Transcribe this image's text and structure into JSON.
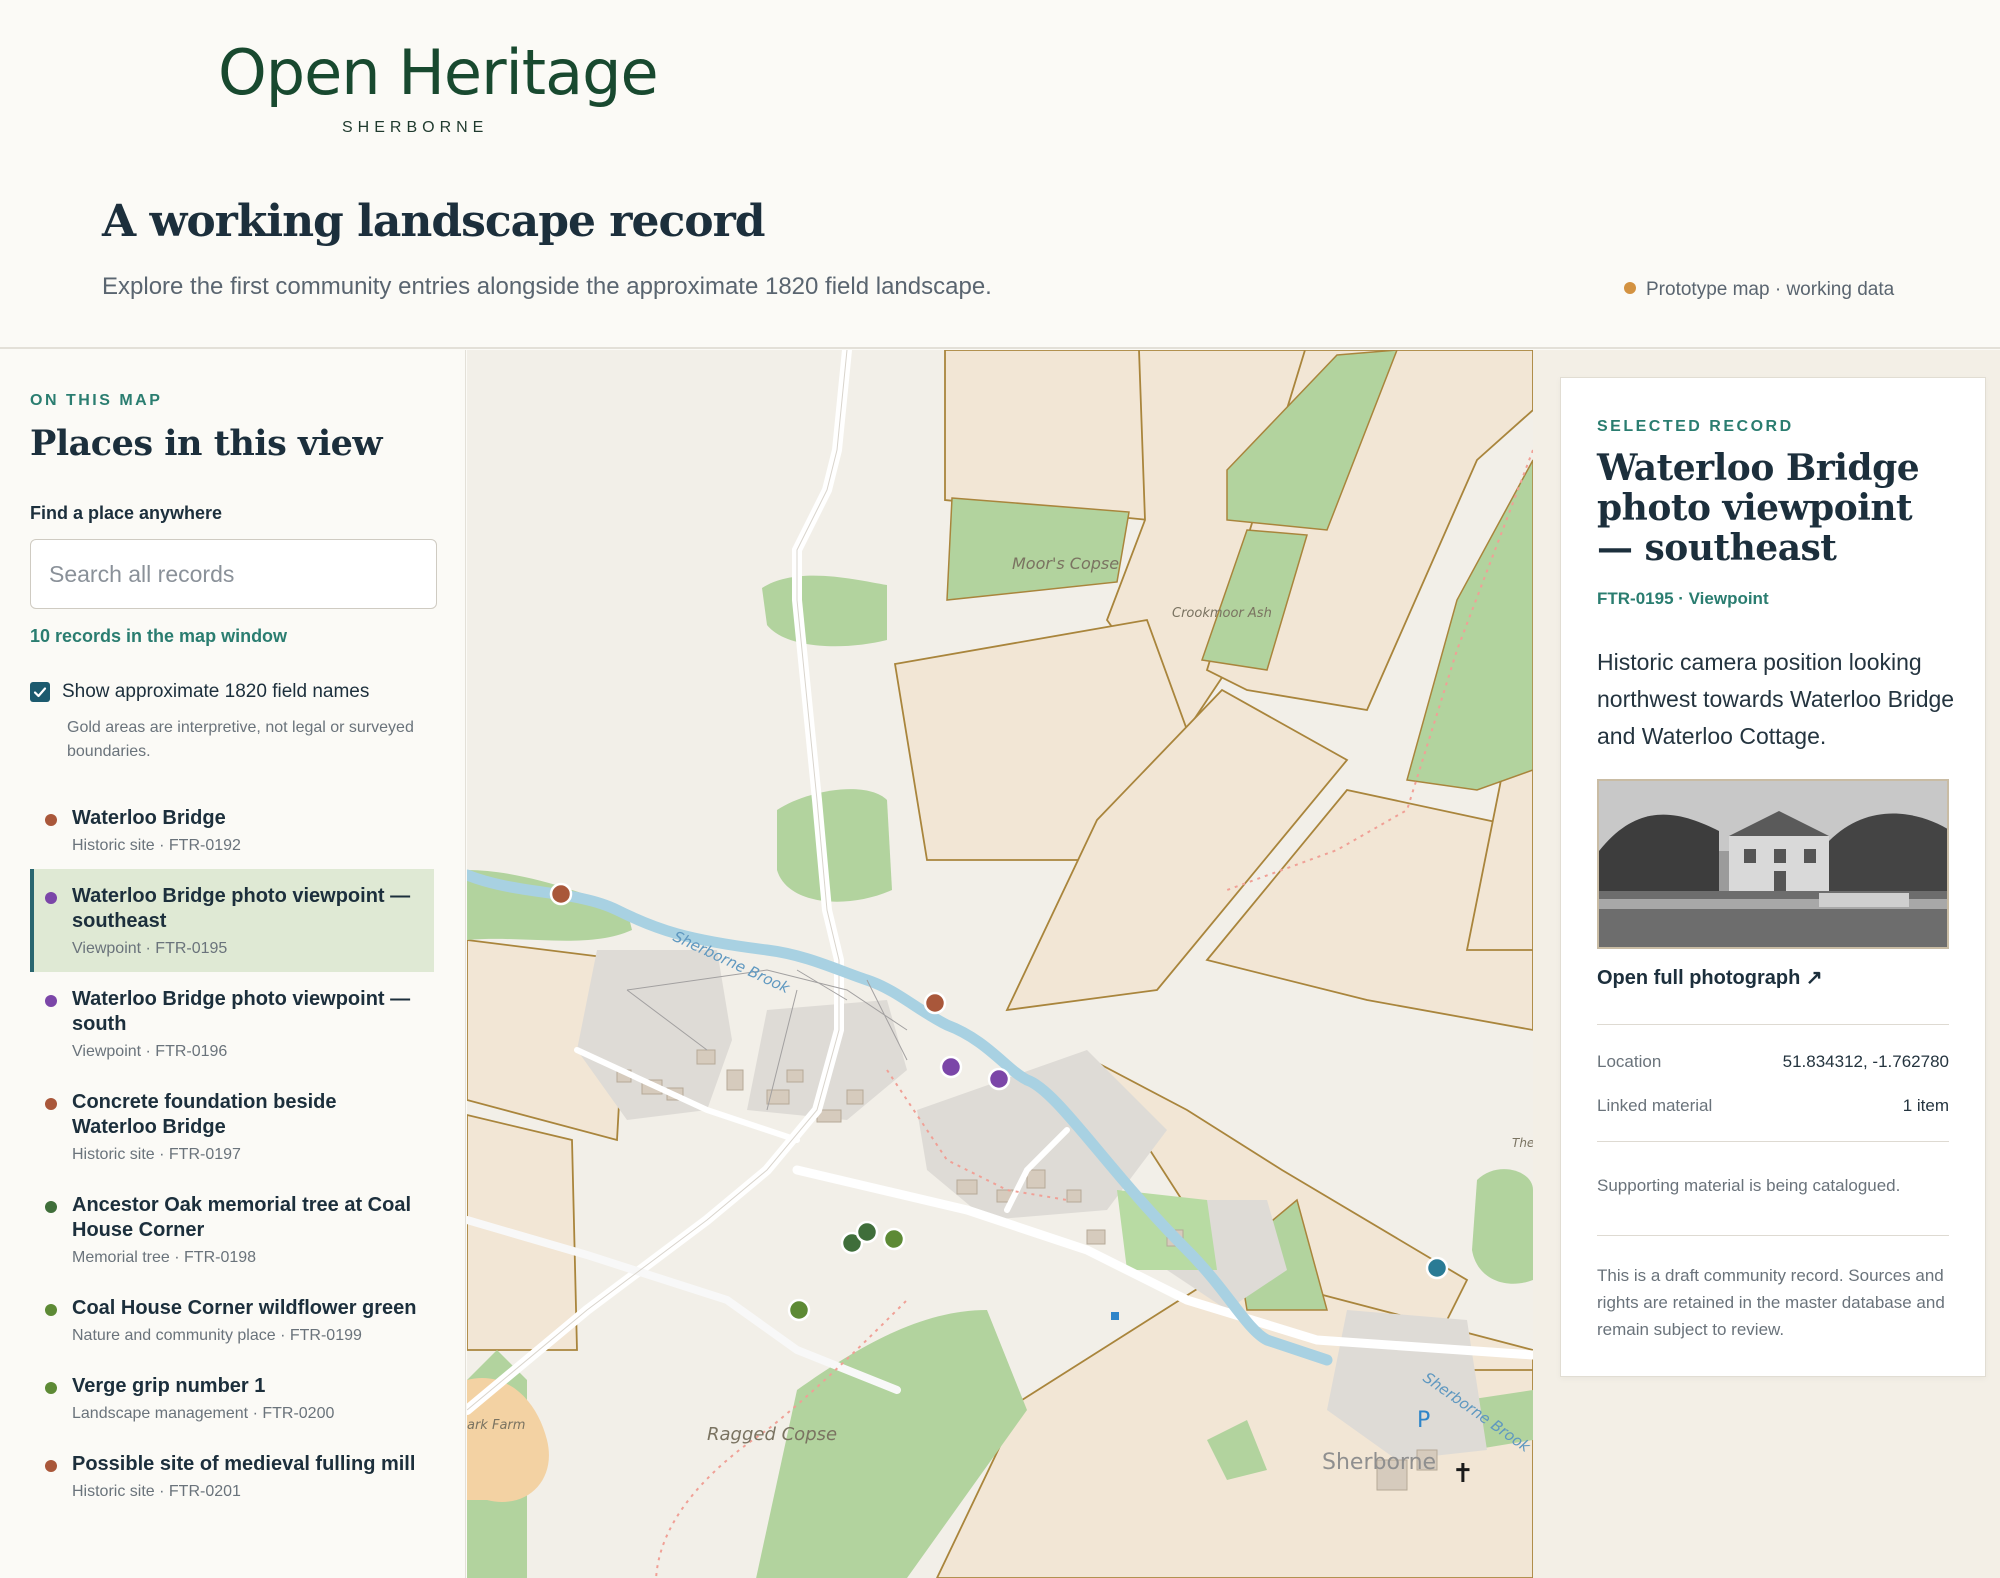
{
  "brand": {
    "title": "Open Heritage",
    "subtitle": "SHERBORNE"
  },
  "page": {
    "title": "A working landscape record",
    "description": "Explore the first community entries alongside the approximate 1820 field landscape.",
    "status": "Prototype map · working data",
    "status_color": "#d39241"
  },
  "sidebar": {
    "eyebrow": "ON THIS MAP",
    "title": "Places in this view",
    "find_label": "Find a place anywhere",
    "search_placeholder": "Search all records",
    "count_text": "10 records in the map window",
    "toggle_label": "Show approximate 1820 field names",
    "toggle_checked": true,
    "toggle_note": "Gold areas are interpretive, not legal or surveyed boundaries.",
    "records": [
      {
        "name": "Waterloo Bridge",
        "meta": "Historic site · FTR-0192",
        "color": "#a9573a",
        "selected": false
      },
      {
        "name": "Waterloo Bridge photo viewpoint — southeast",
        "meta": "Viewpoint · FTR-0195",
        "color": "#7b46a8",
        "selected": true
      },
      {
        "name": "Waterloo Bridge photo viewpoint — south",
        "meta": "Viewpoint · FTR-0196",
        "color": "#7b46a8",
        "selected": false
      },
      {
        "name": "Concrete foundation beside Waterloo Bridge",
        "meta": "Historic site · FTR-0197",
        "color": "#a9573a",
        "selected": false
      },
      {
        "name": "Ancestor Oak memorial tree at Coal House Corner",
        "meta": "Memorial tree · FTR-0198",
        "color": "#3f6e3a",
        "selected": false
      },
      {
        "name": "Coal House Corner wildflower green",
        "meta": "Nature and community place · FTR-0199",
        "color": "#5d8a35",
        "selected": false
      },
      {
        "name": "Verge grip number 1",
        "meta": "Landscape management · FTR-0200",
        "color": "#5d8a35",
        "selected": false
      },
      {
        "name": "Possible site of medieval fulling mill",
        "meta": "Historic site · FTR-0201",
        "color": "#a9573a",
        "selected": false
      }
    ]
  },
  "map": {
    "labels": {
      "moors_copse": "Moor's Copse",
      "crookmoor_ash": "Crookmoor Ash",
      "sherborne_brook": "Sherborne Brook",
      "sherborne_brook_2": "Sherborne Brook",
      "ragged_copse": "Ragged Copse",
      "park_farm": "ark Farm",
      "sherborne": "Sherborne",
      "th": "The",
      "parking": "P"
    }
  },
  "detail": {
    "eyebrow": "SELECTED RECORD",
    "title": "Waterloo Bridge photo viewpoint — southeast",
    "id_line": "FTR-0195 · Viewpoint",
    "description": "Historic camera position looking northwest towards Waterloo Bridge and Waterloo Cottage.",
    "link": "Open full photograph ↗",
    "location_label": "Location",
    "location_value": "51.834312, -1.762780",
    "linked_label": "Linked material",
    "linked_value": "1 item",
    "support_note": "Supporting material is being catalogued.",
    "draft_note": "This is a draft community record. Sources and rights are retained in the master database and remain subject to review."
  }
}
